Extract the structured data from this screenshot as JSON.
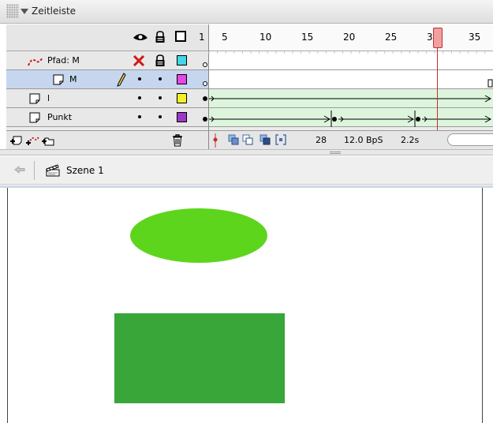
{
  "panel": {
    "title": "Zeitleiste"
  },
  "ruler": {
    "marks": [
      "1",
      "5",
      "10",
      "15",
      "20",
      "25",
      "30",
      "35"
    ],
    "current_frame": 28
  },
  "layers": [
    {
      "name": "Pfad: M",
      "type": "guide",
      "visible": "x",
      "lock": true,
      "color": "#44d6e6"
    },
    {
      "name": "M",
      "type": "guided-layer",
      "selected": true,
      "editing": true,
      "color": "#e646e6"
    },
    {
      "name": "l",
      "type": "layer",
      "color": "#f4f028"
    },
    {
      "name": "Punkt",
      "type": "layer",
      "color": "#9a3bc8"
    }
  ],
  "status": {
    "frame": "28",
    "fps": "12.0 BpS",
    "time": "2.2s"
  },
  "editbar": {
    "scene": "Szene 1"
  },
  "colors": {
    "ellipse": "#5dd51d",
    "rectangle": "#38a638",
    "playhead": "#c03030",
    "tween": "#ddf5dd",
    "selection": "#c6d6ee"
  }
}
